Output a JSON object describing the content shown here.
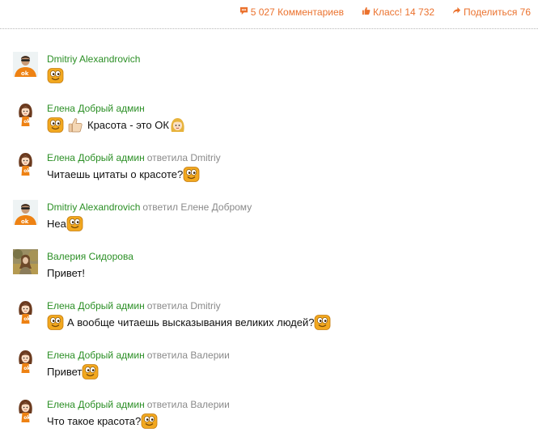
{
  "actions": {
    "comments_label": "5 027 Комментариев",
    "class_label": "Класс! 14 732",
    "share_label": "Поделиться 76"
  },
  "colors": {
    "accent": "#eb722e",
    "author": "#2b8f25",
    "muted": "#8a8a8a"
  },
  "comments": [
    {
      "author": "Dmitriy Alexandrovich",
      "avatar": "ok-orange-shirt",
      "replied": "",
      "text_before": "",
      "emojis_before": [
        "smile-emoji"
      ],
      "text": "",
      "emojis_after": []
    },
    {
      "author": "Елена Добрый админ",
      "avatar": "elena-cartoon",
      "replied": "",
      "text_before": "",
      "emojis_before": [
        "smile-emoji",
        "thumbs-up-emoji"
      ],
      "text": "Красота - это ОК",
      "emojis_after": [
        "girl-emoji"
      ]
    },
    {
      "author": "Елена Добрый админ",
      "avatar": "elena-cartoon",
      "replied": "ответила Dmitriy",
      "text": "Читаешь цитаты о красоте?",
      "emojis_before": [],
      "emojis_after": [
        "smile-emoji"
      ]
    },
    {
      "author": "Dmitriy Alexandrovich",
      "avatar": "ok-orange-shirt",
      "replied": "ответил Елене Доброму",
      "text": "Неа",
      "emojis_before": [],
      "emojis_after": [
        "smile-emoji"
      ]
    },
    {
      "author": "Валерия Сидорова",
      "avatar": "photo-autumn",
      "replied": "",
      "text": "Привет!",
      "emojis_before": [],
      "emojis_after": []
    },
    {
      "author": "Елена Добрый админ",
      "avatar": "elena-cartoon",
      "replied": "ответила Dmitriy",
      "text": "А вообще читаешь высказывания великих людей?",
      "emojis_before": [
        "smile-emoji"
      ],
      "emojis_after": [
        "smile-emoji"
      ]
    },
    {
      "author": "Елена Добрый админ",
      "avatar": "elena-cartoon",
      "replied": "ответила Валерии",
      "text": "Привет",
      "emojis_before": [],
      "emojis_after": [
        "smile-emoji"
      ]
    },
    {
      "author": "Елена Добрый админ",
      "avatar": "elena-cartoon",
      "replied": "ответила Валерии",
      "text": "Что такое красота?",
      "emojis_before": [],
      "emojis_after": [
        "smile-emoji"
      ]
    }
  ]
}
